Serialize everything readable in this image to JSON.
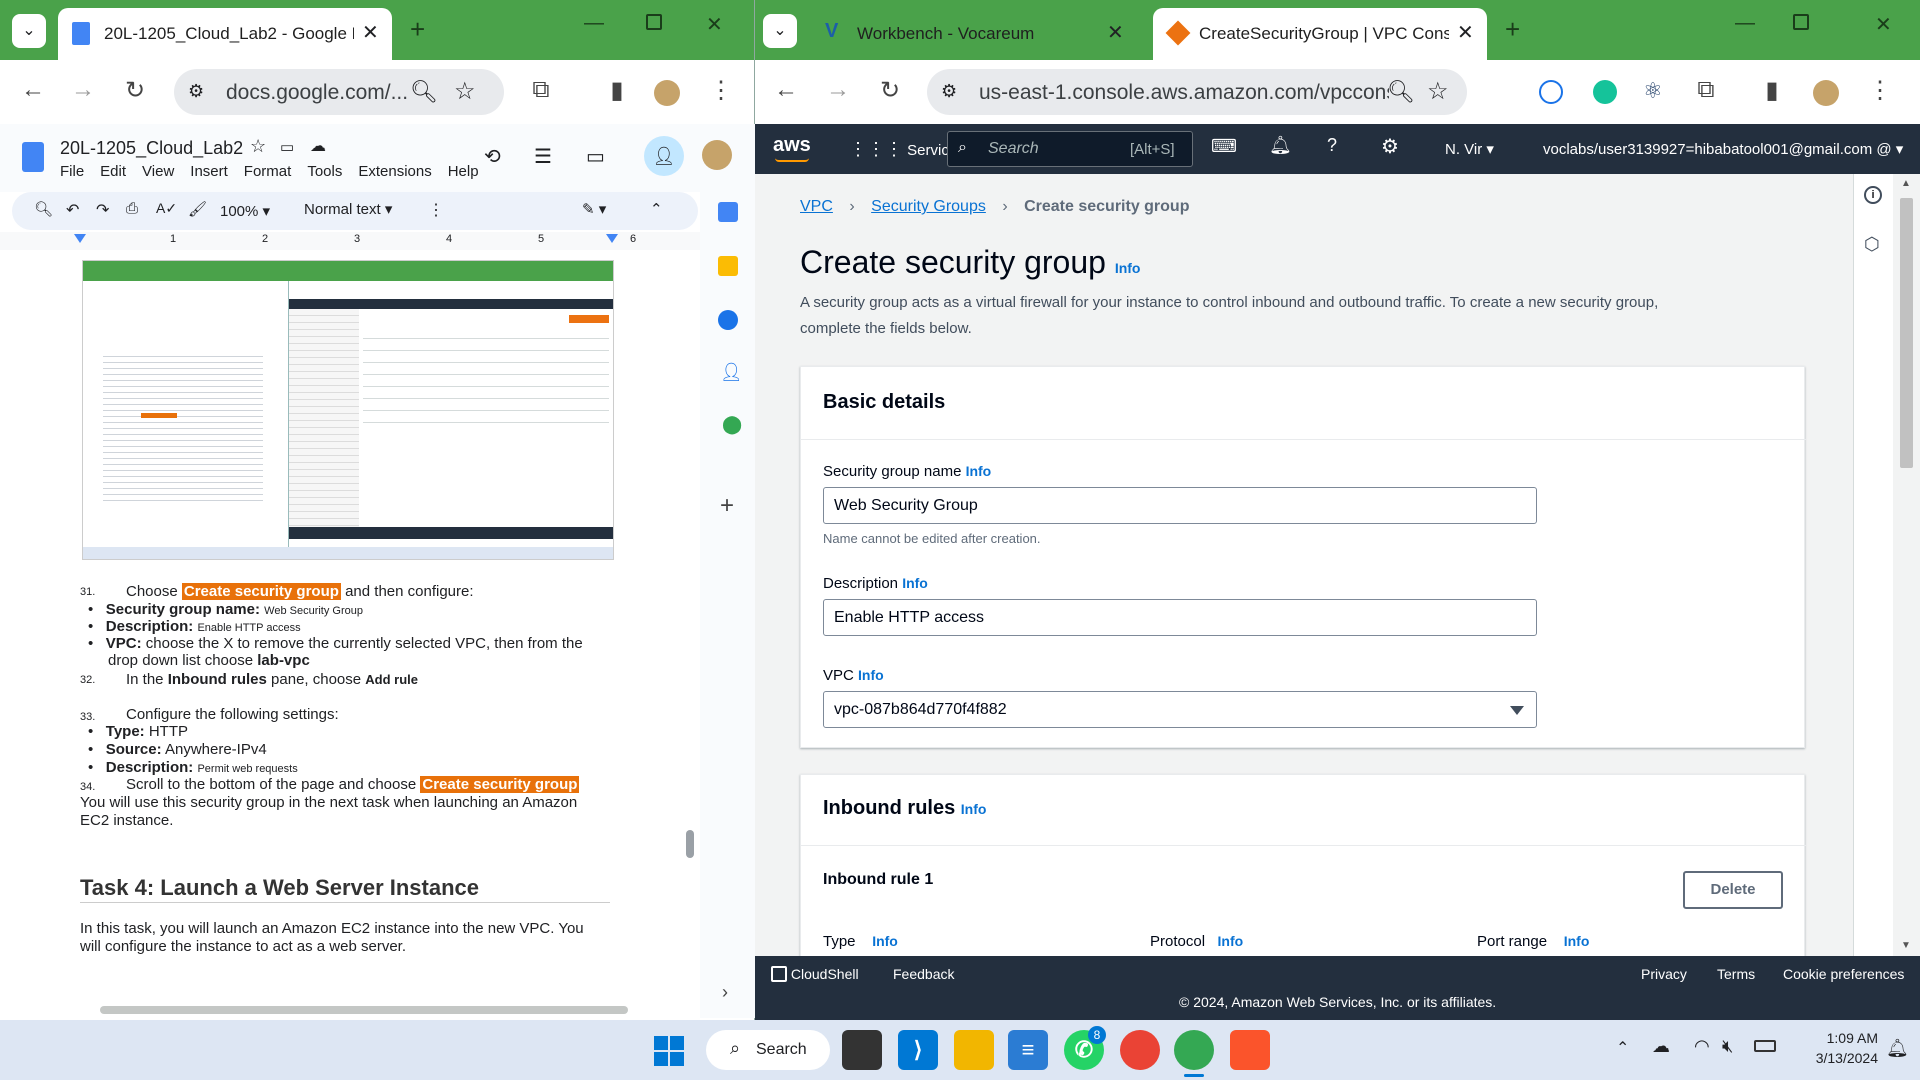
{
  "left_window": {
    "tab_title": "20L-1205_Cloud_Lab2 - Google Do",
    "url": "docs.google.com/...",
    "doc_title": "20L-1205_Cloud_Lab2",
    "menu": [
      "File",
      "Edit",
      "View",
      "Insert",
      "Format",
      "Tools",
      "Extensions",
      "Help"
    ],
    "zoom": "100%",
    "style": "Normal text",
    "ruler_marks": [
      "1",
      "2",
      "3",
      "4",
      "5",
      "6"
    ],
    "lines": {
      "n31": "31.",
      "choose": "Choose",
      "create_sg": "Create security group",
      "then_configure": "and then configure:",
      "sg_name_label": "Security group name:",
      "sg_name_val": "Web Security Group",
      "desc_label": "Description:",
      "desc_val": "Enable HTTP access",
      "vpc_label": "VPC:",
      "vpc_text": "choose the X to remove the currently selected VPC, then from the",
      "vpc_text2": "drop down list choose",
      "lab_vpc": "lab-vpc",
      "n32": "32.",
      "inbound_pre": "In the",
      "inbound_rules": "Inbound rules",
      "pane_choose": "pane, choose",
      "add_rule": "Add rule",
      "n33": "33.",
      "configure": "Configure the following settings:",
      "type_label": "Type:",
      "type_val": "HTTP",
      "source_label": "Source:",
      "source_val": "Anywhere-IPv4",
      "desc2_label": "Description:",
      "desc2_val": "Permit web requests",
      "n34": "34.",
      "scroll": "Scroll to the bottom of the page and choose",
      "create_sg2": "Create security group",
      "use_line1": "You will use this security group in the next task when launching an Amazon",
      "use_line2": "EC2 instance.",
      "task4": "Task 4: Launch a Web Server Instance",
      "task4_p1": "In this task, you will launch an Amazon EC2 instance into the new VPC. You",
      "task4_p2": "will configure the instance to act as a web server."
    }
  },
  "right_window": {
    "tab1_title": "Workbench - Vocareum",
    "tab2_title": "CreateSecurityGroup | VPC Consol",
    "url": "us-east-1.console.aws.amazon.com/vpcconsole...",
    "nav": {
      "services": "Services",
      "search_placeholder": "Search",
      "shortcut": "[Alt+S]",
      "region": "N. Vir",
      "account": "voclabs/user3139927=hibabatool001@gmail.com @"
    },
    "breadcrumb": [
      "VPC",
      "Security Groups",
      "Create security group"
    ],
    "page_title": "Create security group",
    "info": "Info",
    "description": "A security group acts as a virtual firewall for your instance to control inbound and outbound traffic. To create a new security group,",
    "description2": "complete the fields below.",
    "basic_details": "Basic details",
    "sg_name_label": "Security group name",
    "sg_name_value": "Web Security Group",
    "sg_name_hint": "Name cannot be edited after creation.",
    "desc_label": "Description",
    "desc_value": "Enable HTTP access",
    "vpc_label": "VPC",
    "vpc_value": "vpc-087b864d770f4f882",
    "inbound_rules": "Inbound rules",
    "inbound_rule_1": "Inbound rule 1",
    "delete": "Delete",
    "type": "Type",
    "protocol": "Protocol",
    "port_range": "Port range",
    "footer": {
      "cloudshell": "CloudShell",
      "feedback": "Feedback",
      "privacy": "Privacy",
      "terms": "Terms",
      "cookie": "Cookie preferences",
      "copyright": "© 2024, Amazon Web Services, Inc. or its affiliates."
    }
  },
  "taskbar": {
    "search": "Search",
    "whatsapp_badge": "8",
    "time": "1:09 AM",
    "date": "3/13/2024"
  }
}
